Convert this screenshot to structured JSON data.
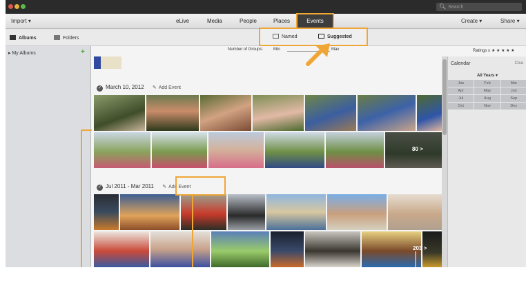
{
  "titlebar": {
    "search_placeholder": "Search"
  },
  "toolbar": {
    "import": "Import",
    "tabs": [
      "eLive",
      "Media",
      "People",
      "Places",
      "Events"
    ],
    "create": "Create",
    "share": "Share"
  },
  "subbar": {
    "albums": "Albums",
    "folders": "Folders",
    "named": "Named",
    "suggested": "Suggested"
  },
  "options": {
    "groups_label": "Number of Groups:",
    "min": "Min",
    "max": "Max",
    "ratings": "Ratings"
  },
  "sidebar": {
    "my_albums": "My Albums"
  },
  "events": [
    {
      "title": "March 10, 2012",
      "add_event": "Add Event",
      "more": "80 >"
    },
    {
      "title": "Jul 2011 - Mar 2011",
      "add_event": "Add Event",
      "more": "203 >"
    }
  ],
  "calendar": {
    "title": "Calendar",
    "clear": "Clea",
    "years": "All Years",
    "months": [
      "Jan",
      "Feb",
      "Mar",
      "Apr",
      "May",
      "Jun",
      "Jul",
      "Aug",
      "Sep",
      "Oct",
      "Nov",
      "Dec"
    ]
  },
  "colors": {
    "accent": "#f0a637",
    "selected_tab": "#3d3d3d"
  }
}
